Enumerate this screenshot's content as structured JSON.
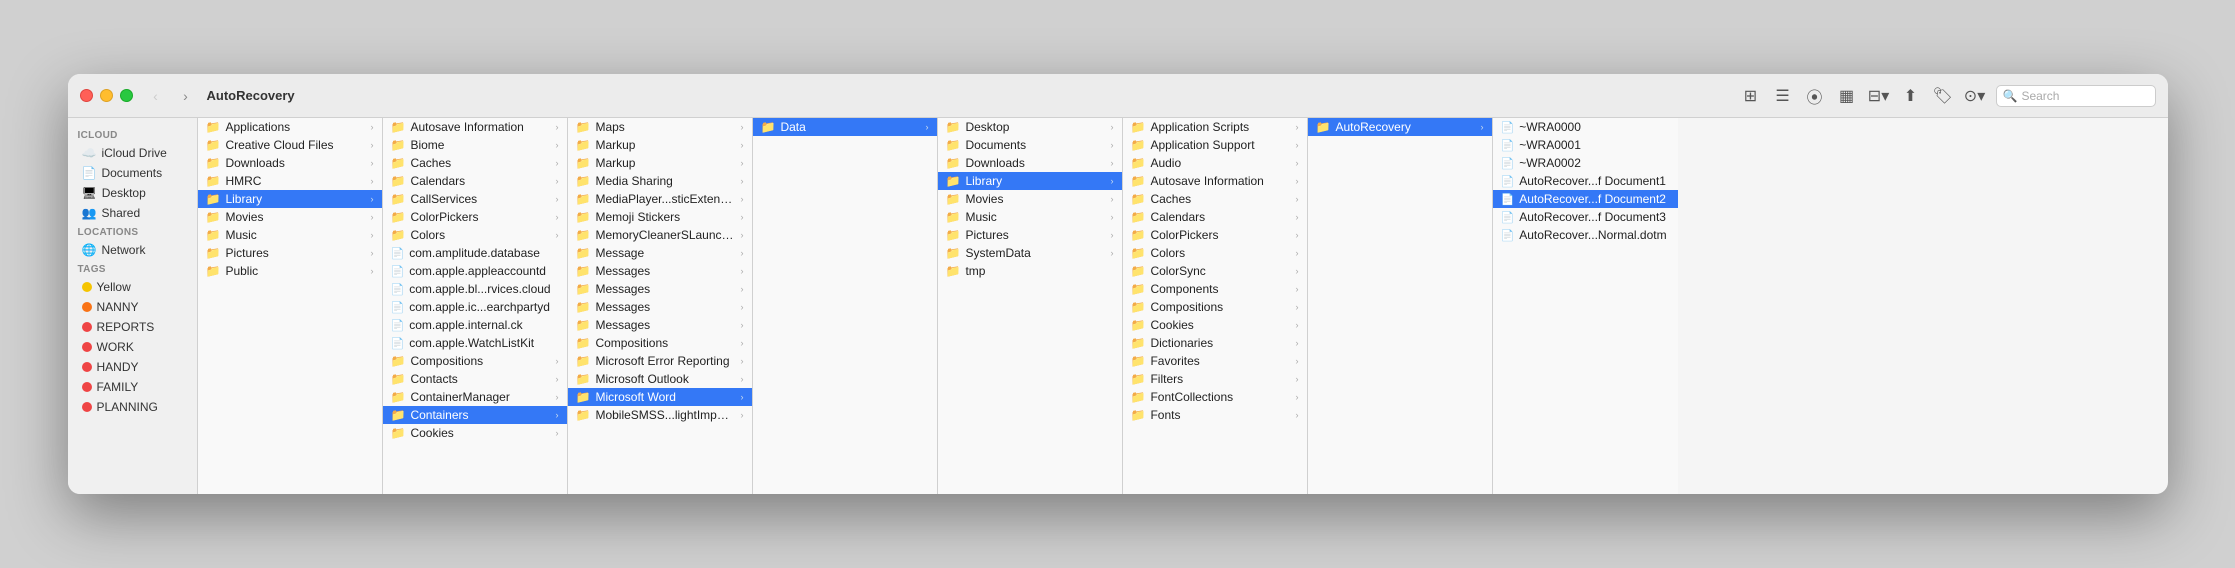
{
  "window": {
    "title": "AutoRecovery",
    "search_placeholder": "Search"
  },
  "sidebar": {
    "icloud_section": "iCloud",
    "items_icloud": [
      {
        "label": "iCloud Drive",
        "icon": "☁️"
      },
      {
        "label": "Documents",
        "icon": "📄"
      },
      {
        "label": "Desktop",
        "icon": "🖥"
      },
      {
        "label": "Shared",
        "icon": "👥"
      }
    ],
    "locations_section": "Locations",
    "items_locations": [
      {
        "label": "Network",
        "icon": "🌐"
      }
    ],
    "tags_section": "Tags",
    "tags": [
      {
        "label": "Yellow",
        "color": "#f5c400"
      },
      {
        "label": "NANNY",
        "color": "#f97316"
      },
      {
        "label": "REPORTS",
        "color": "#ef4444"
      },
      {
        "label": "WORK",
        "color": "#ef4444"
      },
      {
        "label": "HANDY",
        "color": "#ef4444"
      },
      {
        "label": "FAMILY",
        "color": "#ef4444"
      },
      {
        "label": "PLANNING",
        "color": "#ef4444"
      }
    ]
  },
  "columns": [
    {
      "id": "col1",
      "items": [
        {
          "label": "Applications",
          "type": "folder",
          "has_arrow": true
        },
        {
          "label": "Creative Cloud Files",
          "type": "folder",
          "has_arrow": true
        },
        {
          "label": "Downloads",
          "type": "folder",
          "has_arrow": true
        },
        {
          "label": "HMRC",
          "type": "folder",
          "has_arrow": true
        },
        {
          "label": "Library",
          "type": "folder",
          "selected": true,
          "has_arrow": true
        },
        {
          "label": "Movies",
          "type": "folder",
          "has_arrow": true
        },
        {
          "label": "Music",
          "type": "folder",
          "has_arrow": true
        },
        {
          "label": "Pictures",
          "type": "folder",
          "has_arrow": true
        },
        {
          "label": "Public",
          "type": "folder",
          "has_arrow": true
        }
      ]
    },
    {
      "id": "col2",
      "items": [
        {
          "label": "Autosave Information",
          "type": "folder",
          "has_arrow": true
        },
        {
          "label": "Biome",
          "type": "folder",
          "has_arrow": true
        },
        {
          "label": "Caches",
          "type": "folder",
          "has_arrow": true
        },
        {
          "label": "Calendars",
          "type": "folder",
          "has_arrow": true
        },
        {
          "label": "CallServices",
          "type": "folder",
          "has_arrow": true
        },
        {
          "label": "ColorPickers",
          "type": "folder",
          "has_arrow": true
        },
        {
          "label": "Colors",
          "type": "folder",
          "has_arrow": true
        },
        {
          "label": "com.amplitude.database",
          "type": "file",
          "has_arrow": false
        },
        {
          "label": "com.apple.appleaccountd",
          "type": "file",
          "has_arrow": false
        },
        {
          "label": "com.apple.bl...rvices.cloud",
          "type": "file",
          "has_arrow": false
        },
        {
          "label": "com.apple.ic...earchpartyd",
          "type": "file",
          "has_arrow": false
        },
        {
          "label": "com.apple.internal.ck",
          "type": "file",
          "has_arrow": false
        },
        {
          "label": "com.apple.WatchListKit",
          "type": "file",
          "has_arrow": false
        },
        {
          "label": "Compositions",
          "type": "folder",
          "has_arrow": true
        },
        {
          "label": "Contacts",
          "type": "folder",
          "has_arrow": true
        },
        {
          "label": "ContainerManager",
          "type": "folder",
          "has_arrow": true
        },
        {
          "label": "Containers",
          "type": "folder",
          "selected": true,
          "has_arrow": true
        },
        {
          "label": "Cookies",
          "type": "folder",
          "has_arrow": true
        }
      ]
    },
    {
      "id": "col3",
      "items": [
        {
          "label": "Maps",
          "type": "folder",
          "has_arrow": true
        },
        {
          "label": "Markup",
          "type": "folder",
          "has_arrow": true
        },
        {
          "label": "Markup",
          "type": "folder",
          "has_arrow": true
        },
        {
          "label": "Media Sharing",
          "type": "folder",
          "has_arrow": true
        },
        {
          "label": "MediaPlayer...sticExtension",
          "type": "folder",
          "has_arrow": true
        },
        {
          "label": "Memoji Stickers",
          "type": "folder",
          "has_arrow": true
        },
        {
          "label": "MemoryCleanerSLauncher",
          "type": "folder",
          "has_arrow": true
        },
        {
          "label": "Message",
          "type": "folder",
          "has_arrow": true
        },
        {
          "label": "Messages",
          "type": "folder",
          "has_arrow": true
        },
        {
          "label": "Messages",
          "type": "folder",
          "has_arrow": true
        },
        {
          "label": "Messages",
          "type": "folder",
          "has_arrow": true
        },
        {
          "label": "Messages",
          "type": "folder",
          "has_arrow": true
        },
        {
          "label": "Compositions",
          "type": "folder",
          "has_arrow": true
        },
        {
          "label": "Microsoft Error Reporting",
          "type": "folder",
          "has_arrow": true
        },
        {
          "label": "Microsoft Outlook",
          "type": "folder",
          "has_arrow": true
        },
        {
          "label": "Microsoft Word",
          "type": "folder",
          "selected": true,
          "has_arrow": true
        },
        {
          "label": "MobileSMSS...lightImporter",
          "type": "folder",
          "has_arrow": true
        }
      ]
    },
    {
      "id": "col4",
      "items": [
        {
          "label": "Data",
          "type": "folder",
          "selected": true,
          "has_arrow": true
        }
      ]
    },
    {
      "id": "col5",
      "items": [
        {
          "label": "Desktop",
          "type": "folder",
          "has_arrow": true
        },
        {
          "label": "Documents",
          "type": "folder",
          "has_arrow": true
        },
        {
          "label": "Downloads",
          "type": "folder",
          "has_arrow": true
        },
        {
          "label": "Library",
          "type": "folder",
          "selected": true,
          "has_arrow": true
        },
        {
          "label": "Movies",
          "type": "folder",
          "has_arrow": true
        },
        {
          "label": "Music",
          "type": "folder",
          "has_arrow": true
        },
        {
          "label": "Pictures",
          "type": "folder",
          "has_arrow": true
        },
        {
          "label": "SystemData",
          "type": "folder",
          "has_arrow": true
        },
        {
          "label": "tmp",
          "type": "folder",
          "has_arrow": false
        }
      ]
    },
    {
      "id": "col6",
      "items": [
        {
          "label": "Application Scripts",
          "type": "folder",
          "has_arrow": true
        },
        {
          "label": "Application Support",
          "type": "folder",
          "has_arrow": true
        },
        {
          "label": "Audio",
          "type": "folder",
          "has_arrow": true
        },
        {
          "label": "Autosave Information",
          "type": "folder",
          "has_arrow": true
        },
        {
          "label": "Caches",
          "type": "folder",
          "has_arrow": true
        },
        {
          "label": "Calendars",
          "type": "folder",
          "has_arrow": true
        },
        {
          "label": "ColorPickers",
          "type": "folder",
          "has_arrow": true
        },
        {
          "label": "Colors",
          "type": "folder",
          "has_arrow": true
        },
        {
          "label": "ColorSync",
          "type": "folder",
          "has_arrow": true
        },
        {
          "label": "Components",
          "type": "folder",
          "has_arrow": true
        },
        {
          "label": "Compositions",
          "type": "folder",
          "has_arrow": true
        },
        {
          "label": "Cookies",
          "type": "folder",
          "has_arrow": true
        },
        {
          "label": "Dictionaries",
          "type": "folder",
          "has_arrow": true
        },
        {
          "label": "Favorites",
          "type": "folder",
          "has_arrow": true
        },
        {
          "label": "Filters",
          "type": "folder",
          "has_arrow": true
        },
        {
          "label": "FontCollections",
          "type": "folder",
          "has_arrow": true
        },
        {
          "label": "Fonts",
          "type": "folder",
          "has_arrow": true
        }
      ]
    },
    {
      "id": "col7",
      "items": [
        {
          "label": "AutoRecovery",
          "type": "folder",
          "selected": true,
          "has_arrow": true
        }
      ]
    },
    {
      "id": "col8",
      "items": [
        {
          "label": "~WRA0000",
          "type": "file",
          "has_arrow": false
        },
        {
          "label": "~WRA0001",
          "type": "file",
          "has_arrow": false
        },
        {
          "label": "~WRA0002",
          "type": "file",
          "has_arrow": false
        },
        {
          "label": "AutoRecover...f Document1",
          "type": "file",
          "has_arrow": false
        },
        {
          "label": "AutoRecover...f Document2",
          "type": "file",
          "selected": true,
          "has_arrow": false
        },
        {
          "label": "AutoRecover...f Document3",
          "type": "file",
          "has_arrow": false
        },
        {
          "label": "AutoRecover...Normal.dotm",
          "type": "file",
          "has_arrow": false
        }
      ]
    }
  ]
}
